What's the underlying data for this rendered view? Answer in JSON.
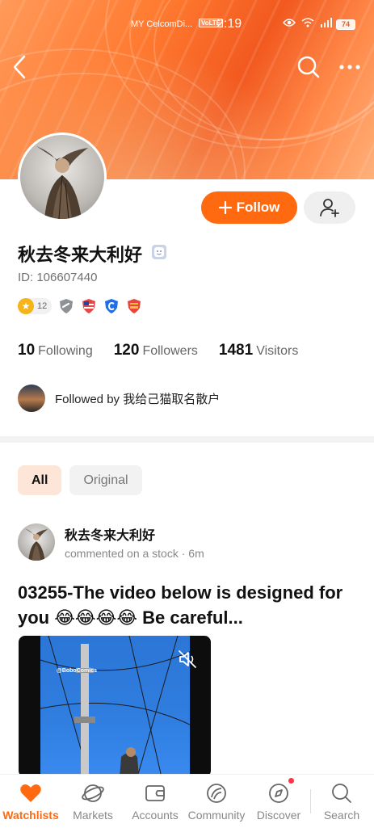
{
  "status_bar": {
    "carrier": "MY CelcomDi...",
    "volte": "VoLTE",
    "time": "2:19",
    "battery": "74"
  },
  "header": {
    "back_icon": "chevron-left-icon",
    "search_icon": "search-icon",
    "more_icon": "more-horizontal-icon",
    "banner_color": "#ff7a30"
  },
  "profile": {
    "name": "秋去冬来大利好",
    "user_id": "ID: 106607440",
    "follow_label": "Follow",
    "level": "12",
    "stats": [
      {
        "count": "10",
        "label": "Following"
      },
      {
        "count": "120",
        "label": "Followers"
      },
      {
        "count": "1481",
        "label": "Visitors"
      }
    ],
    "followed_by_prefix": "Followed by ",
    "followed_by_name": "我给己猫取名散户",
    "accent": "#ff6a10"
  },
  "filters": {
    "all": "All",
    "original": "Original"
  },
  "post": {
    "author": "秋去冬来大利好",
    "meta": "commented on a stock · 6m",
    "title": "03255-The video below is designed for you 😂😂😂😂 Be careful...",
    "video_watermark": "@BoboComics"
  },
  "tabbar": {
    "tabs": [
      {
        "label": "Watchlists",
        "icon": "heart-icon"
      },
      {
        "label": "Markets",
        "icon": "planet-icon"
      },
      {
        "label": "Accounts",
        "icon": "wallet-icon"
      },
      {
        "label": "Community",
        "icon": "community-icon"
      },
      {
        "label": "Discover",
        "icon": "compass-icon"
      },
      {
        "label": "Search",
        "icon": "search-icon"
      }
    ]
  }
}
